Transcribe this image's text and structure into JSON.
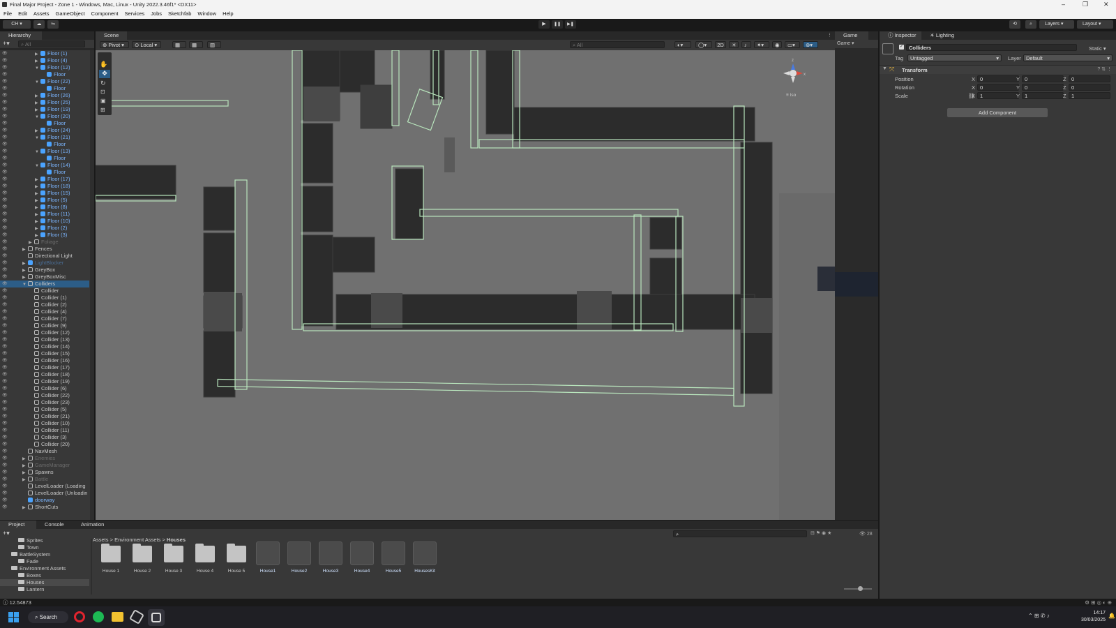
{
  "window": {
    "title": "Final Major Project - Zone 1 - Windows, Mac, Linux - Unity 2022.3.46f1* <DX11>",
    "minimize": "–",
    "maximize": "❐",
    "close": "✕"
  },
  "menu": [
    "File",
    "Edit",
    "Assets",
    "GameObject",
    "Component",
    "Services",
    "Jobs",
    "Sketchfab",
    "Window",
    "Help"
  ],
  "toolbar": {
    "account": "CH ▾",
    "play": "▶",
    "pause": "❚❚",
    "step": "▶❚",
    "layers": "Layers",
    "layout": "Layout"
  },
  "hierarchy": {
    "tab": "Hierarchy",
    "search_placeholder": "All",
    "rows": [
      {
        "label": "Floor (1)",
        "indent": 2,
        "arrow": "▶",
        "kind": "prefab"
      },
      {
        "label": "Floor (4)",
        "indent": 2,
        "arrow": "▶",
        "kind": "prefab"
      },
      {
        "label": "Floor (12)",
        "indent": 2,
        "arrow": "▼",
        "kind": "prefab"
      },
      {
        "label": "Floor",
        "indent": 3,
        "arrow": "",
        "kind": "prefab"
      },
      {
        "label": "Floor (22)",
        "indent": 2,
        "arrow": "▼",
        "kind": "prefab"
      },
      {
        "label": "Floor",
        "indent": 3,
        "arrow": "",
        "kind": "prefab"
      },
      {
        "label": "Floor (26)",
        "indent": 2,
        "arrow": "▶",
        "kind": "prefab"
      },
      {
        "label": "Floor (25)",
        "indent": 2,
        "arrow": "▶",
        "kind": "prefab"
      },
      {
        "label": "Floor (19)",
        "indent": 2,
        "arrow": "▶",
        "kind": "prefab"
      },
      {
        "label": "Floor (20)",
        "indent": 2,
        "arrow": "▼",
        "kind": "prefab"
      },
      {
        "label": "Floor",
        "indent": 3,
        "arrow": "",
        "kind": "prefab"
      },
      {
        "label": "Floor (24)",
        "indent": 2,
        "arrow": "▶",
        "kind": "prefab"
      },
      {
        "label": "Floor (21)",
        "indent": 2,
        "arrow": "▼",
        "kind": "prefab"
      },
      {
        "label": "Floor",
        "indent": 3,
        "arrow": "",
        "kind": "prefab"
      },
      {
        "label": "Floor (13)",
        "indent": 2,
        "arrow": "▼",
        "kind": "prefab"
      },
      {
        "label": "Floor",
        "indent": 3,
        "arrow": "",
        "kind": "prefab"
      },
      {
        "label": "Floor (14)",
        "indent": 2,
        "arrow": "▼",
        "kind": "prefab"
      },
      {
        "label": "Floor",
        "indent": 3,
        "arrow": "",
        "kind": "prefab"
      },
      {
        "label": "Floor (17)",
        "indent": 2,
        "arrow": "▶",
        "kind": "prefab"
      },
      {
        "label": "Floor (18)",
        "indent": 2,
        "arrow": "▶",
        "kind": "prefab"
      },
      {
        "label": "Floor (15)",
        "indent": 2,
        "arrow": "▶",
        "kind": "prefab"
      },
      {
        "label": "Floor (5)",
        "indent": 2,
        "arrow": "▶",
        "kind": "prefab"
      },
      {
        "label": "Floor (8)",
        "indent": 2,
        "arrow": "▶",
        "kind": "prefab"
      },
      {
        "label": "Floor (11)",
        "indent": 2,
        "arrow": "▶",
        "kind": "prefab"
      },
      {
        "label": "Floor (10)",
        "indent": 2,
        "arrow": "▶",
        "kind": "prefab"
      },
      {
        "label": "Floor (2)",
        "indent": 2,
        "arrow": "▶",
        "kind": "prefab"
      },
      {
        "label": "Floor (3)",
        "indent": 2,
        "arrow": "▶",
        "kind": "prefab"
      },
      {
        "label": "Foliage",
        "indent": 1,
        "arrow": "▶",
        "kind": "dim"
      },
      {
        "label": "Fences",
        "indent": 0,
        "arrow": "▶",
        "kind": "normal"
      },
      {
        "label": "Directional Light",
        "indent": 0,
        "arrow": "",
        "kind": "normal"
      },
      {
        "label": "LightBlocker",
        "indent": 0,
        "arrow": "▶",
        "kind": "dimblue"
      },
      {
        "label": "GreyBox",
        "indent": 0,
        "arrow": "▶",
        "kind": "normal"
      },
      {
        "label": "GreyBoxMisc",
        "indent": 0,
        "arrow": "▶",
        "kind": "normal"
      },
      {
        "label": "Colliders",
        "indent": 0,
        "arrow": "▼",
        "kind": "selected"
      },
      {
        "label": "Collider",
        "indent": 1,
        "arrow": "",
        "kind": "normal"
      },
      {
        "label": "Collider (1)",
        "indent": 1,
        "arrow": "",
        "kind": "normal"
      },
      {
        "label": "Collider (2)",
        "indent": 1,
        "arrow": "",
        "kind": "normal"
      },
      {
        "label": "Collider (4)",
        "indent": 1,
        "arrow": "",
        "kind": "normal"
      },
      {
        "label": "Collider (7)",
        "indent": 1,
        "arrow": "",
        "kind": "normal"
      },
      {
        "label": "Collider (9)",
        "indent": 1,
        "arrow": "",
        "kind": "normal"
      },
      {
        "label": "Collider (12)",
        "indent": 1,
        "arrow": "",
        "kind": "normal"
      },
      {
        "label": "Collider (13)",
        "indent": 1,
        "arrow": "",
        "kind": "normal"
      },
      {
        "label": "Collider (14)",
        "indent": 1,
        "arrow": "",
        "kind": "normal"
      },
      {
        "label": "Collider (15)",
        "indent": 1,
        "arrow": "",
        "kind": "normal"
      },
      {
        "label": "Collider (16)",
        "indent": 1,
        "arrow": "",
        "kind": "normal"
      },
      {
        "label": "Collider (17)",
        "indent": 1,
        "arrow": "",
        "kind": "normal"
      },
      {
        "label": "Collider (18)",
        "indent": 1,
        "arrow": "",
        "kind": "normal"
      },
      {
        "label": "Collider (19)",
        "indent": 1,
        "arrow": "",
        "kind": "normal"
      },
      {
        "label": "Collider (6)",
        "indent": 1,
        "arrow": "",
        "kind": "normal"
      },
      {
        "label": "Collider (22)",
        "indent": 1,
        "arrow": "",
        "kind": "normal"
      },
      {
        "label": "Collider (23)",
        "indent": 1,
        "arrow": "",
        "kind": "normal"
      },
      {
        "label": "Collider (5)",
        "indent": 1,
        "arrow": "",
        "kind": "normal"
      },
      {
        "label": "Collider (21)",
        "indent": 1,
        "arrow": "",
        "kind": "normal"
      },
      {
        "label": "Collider (10)",
        "indent": 1,
        "arrow": "",
        "kind": "normal"
      },
      {
        "label": "Collider (11)",
        "indent": 1,
        "arrow": "",
        "kind": "normal"
      },
      {
        "label": "Collider (3)",
        "indent": 1,
        "arrow": "",
        "kind": "normal"
      },
      {
        "label": "Collider (20)",
        "indent": 1,
        "arrow": "",
        "kind": "normal"
      },
      {
        "label": "NavMesh",
        "indent": 0,
        "arrow": "",
        "kind": "normal"
      },
      {
        "label": "Enemies",
        "indent": 0,
        "arrow": "▶",
        "kind": "dim"
      },
      {
        "label": "GameManager",
        "indent": 0,
        "arrow": "▶",
        "kind": "dim"
      },
      {
        "label": "Spawns",
        "indent": 0,
        "arrow": "▶",
        "kind": "normal"
      },
      {
        "label": "Battle",
        "indent": 0,
        "arrow": "▶",
        "kind": "dim"
      },
      {
        "label": "LevelLoader (Loading",
        "indent": 0,
        "arrow": "",
        "kind": "normal"
      },
      {
        "label": "LevelLoader (Unloadin",
        "indent": 0,
        "arrow": "",
        "kind": "normal"
      },
      {
        "label": "doorway",
        "indent": 0,
        "arrow": "",
        "kind": "prefab"
      },
      {
        "label": "ShortCuts",
        "indent": 0,
        "arrow": "▶",
        "kind": "normal"
      }
    ]
  },
  "scene": {
    "tab": "Scene",
    "pivot": "Pivot",
    "local": "Local",
    "search_placeholder": "All",
    "btn_2d": "2D",
    "iso_label": "Iso",
    "gizmo_x": "x",
    "gizmo_z": "z"
  },
  "game": {
    "tab": "Game",
    "display": "Game"
  },
  "inspector": {
    "tabs": [
      "Inspector",
      "Lighting"
    ],
    "object_name": "Colliders",
    "static_label": "Static",
    "tag_label": "Tag",
    "tag_value": "Untagged",
    "layer_label": "Layer",
    "layer_value": "Default",
    "component": "Transform",
    "rows": [
      {
        "label": "Position",
        "x": "0",
        "y": "0",
        "z": "0"
      },
      {
        "label": "Rotation",
        "x": "0",
        "y": "0",
        "z": "0"
      },
      {
        "label": "Scale",
        "x": "1",
        "y": "1",
        "z": "1"
      }
    ],
    "add_component": "Add Component"
  },
  "bottom": {
    "tabs": [
      "Project",
      "Console",
      "Animation"
    ],
    "tree": [
      {
        "label": "Sprites",
        "indent": 2
      },
      {
        "label": "Town",
        "indent": 2
      },
      {
        "label": "BattleSystem",
        "indent": 1
      },
      {
        "label": "Fade",
        "indent": 2
      },
      {
        "label": "Environment Assets",
        "indent": 1
      },
      {
        "label": "Boxes",
        "indent": 2
      },
      {
        "label": "Houses",
        "indent": 2,
        "selected": true
      },
      {
        "label": "Lantern",
        "indent": 2
      }
    ],
    "breadcrumb": [
      "Assets",
      "Environment Assets",
      "Houses"
    ],
    "count": "28",
    "assets": [
      {
        "label": "House 1",
        "kind": "folder"
      },
      {
        "label": "House 2",
        "kind": "folder"
      },
      {
        "label": "House 3",
        "kind": "folder"
      },
      {
        "label": "House 4",
        "kind": "folder"
      },
      {
        "label": "House 5",
        "kind": "folder"
      },
      {
        "label": "House1",
        "kind": "prefab"
      },
      {
        "label": "House2",
        "kind": "prefab"
      },
      {
        "label": "House3",
        "kind": "prefab"
      },
      {
        "label": "House4",
        "kind": "prefab"
      },
      {
        "label": "House5",
        "kind": "prefab"
      },
      {
        "label": "HousesKit",
        "kind": "prefab"
      }
    ]
  },
  "status": {
    "value": "12.54873"
  },
  "taskbar": {
    "search": "Search",
    "time": "14:17",
    "date": "30/03/2025"
  }
}
